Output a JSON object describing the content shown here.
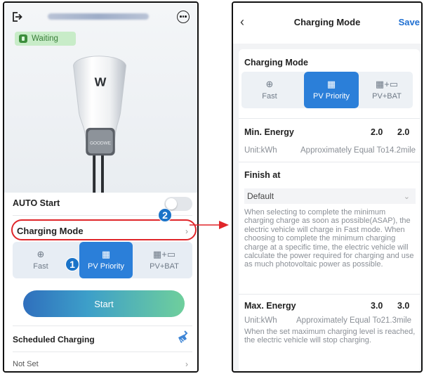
{
  "left": {
    "status": "Waiting",
    "auto_start_label": "AUTO Start",
    "charging_mode_label": "Charging Mode",
    "modes": [
      {
        "label": "Fast",
        "icon": "fast-charge-icon",
        "selected": false
      },
      {
        "label": "PV Priority",
        "icon": "solar-panel-icon",
        "selected": true
      },
      {
        "label": "PV+BAT",
        "icon": "solar-battery-icon",
        "selected": false
      }
    ],
    "start_label": "Start",
    "scheduled_label": "Scheduled Charging",
    "not_set_label": "Not Set",
    "charger_brand": "GOODWE",
    "charger_logo": "W",
    "auto_start_on": false,
    "badge_1": "1",
    "badge_2": "2",
    "highlight_color": "#e0262a"
  },
  "right": {
    "title": "Charging Mode",
    "save_label": "Save",
    "mode_section_title": "Charging Mode",
    "modes": [
      {
        "label": "Fast",
        "icon": "fast-charge-icon",
        "selected": false
      },
      {
        "label": "PV Priority",
        "icon": "solar-panel-icon",
        "selected": true
      },
      {
        "label": "PV+BAT",
        "icon": "solar-battery-icon",
        "selected": false
      }
    ],
    "min_energy": {
      "label": "Min. Energy",
      "value_a": "2.0",
      "value_b": "2.0",
      "unit": "Unit:kWh",
      "approx": "Approximately Equal To14.2mile"
    },
    "finish_at": {
      "label": "Finish at",
      "value": "Default",
      "description": "When selecting to complete the minimum charging charge as soon as possible(ASAP), the electric vehicle will charge in Fast mode. When choosing to complete the minimum charging charge at a specific time, the electric vehicle will calculate the power required for charging and use as much photovoltaic power as possible."
    },
    "max_energy": {
      "label": "Max. Energy",
      "value_a": "3.0",
      "value_b": "3.0",
      "unit": "Unit:kWh",
      "approx": "Approximately Equal To21.3mile",
      "description": "When the set maximum charging level is reached, the electric vehicle will stop charging."
    }
  },
  "colors": {
    "accent": "#2b7fd9",
    "save": "#1f6fd1",
    "badge": "#1a73c8",
    "status_bg": "#c8ecc8",
    "arrow": "#e0262a"
  }
}
